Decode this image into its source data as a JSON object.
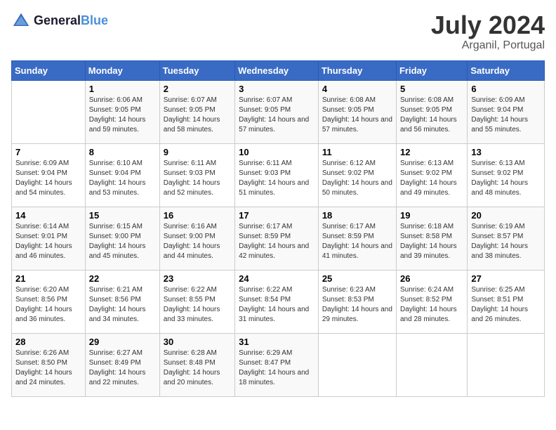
{
  "header": {
    "logo_line1": "General",
    "logo_line2": "Blue",
    "month_year": "July 2024",
    "location": "Arganil, Portugal"
  },
  "weekdays": [
    "Sunday",
    "Monday",
    "Tuesday",
    "Wednesday",
    "Thursday",
    "Friday",
    "Saturday"
  ],
  "weeks": [
    [
      {
        "day": "",
        "sunrise": "",
        "sunset": "",
        "daylight": ""
      },
      {
        "day": "1",
        "sunrise": "Sunrise: 6:06 AM",
        "sunset": "Sunset: 9:05 PM",
        "daylight": "Daylight: 14 hours and 59 minutes."
      },
      {
        "day": "2",
        "sunrise": "Sunrise: 6:07 AM",
        "sunset": "Sunset: 9:05 PM",
        "daylight": "Daylight: 14 hours and 58 minutes."
      },
      {
        "day": "3",
        "sunrise": "Sunrise: 6:07 AM",
        "sunset": "Sunset: 9:05 PM",
        "daylight": "Daylight: 14 hours and 57 minutes."
      },
      {
        "day": "4",
        "sunrise": "Sunrise: 6:08 AM",
        "sunset": "Sunset: 9:05 PM",
        "daylight": "Daylight: 14 hours and 57 minutes."
      },
      {
        "day": "5",
        "sunrise": "Sunrise: 6:08 AM",
        "sunset": "Sunset: 9:05 PM",
        "daylight": "Daylight: 14 hours and 56 minutes."
      },
      {
        "day": "6",
        "sunrise": "Sunrise: 6:09 AM",
        "sunset": "Sunset: 9:04 PM",
        "daylight": "Daylight: 14 hours and 55 minutes."
      }
    ],
    [
      {
        "day": "7",
        "sunrise": "Sunrise: 6:09 AM",
        "sunset": "Sunset: 9:04 PM",
        "daylight": "Daylight: 14 hours and 54 minutes."
      },
      {
        "day": "8",
        "sunrise": "Sunrise: 6:10 AM",
        "sunset": "Sunset: 9:04 PM",
        "daylight": "Daylight: 14 hours and 53 minutes."
      },
      {
        "day": "9",
        "sunrise": "Sunrise: 6:11 AM",
        "sunset": "Sunset: 9:03 PM",
        "daylight": "Daylight: 14 hours and 52 minutes."
      },
      {
        "day": "10",
        "sunrise": "Sunrise: 6:11 AM",
        "sunset": "Sunset: 9:03 PM",
        "daylight": "Daylight: 14 hours and 51 minutes."
      },
      {
        "day": "11",
        "sunrise": "Sunrise: 6:12 AM",
        "sunset": "Sunset: 9:02 PM",
        "daylight": "Daylight: 14 hours and 50 minutes."
      },
      {
        "day": "12",
        "sunrise": "Sunrise: 6:13 AM",
        "sunset": "Sunset: 9:02 PM",
        "daylight": "Daylight: 14 hours and 49 minutes."
      },
      {
        "day": "13",
        "sunrise": "Sunrise: 6:13 AM",
        "sunset": "Sunset: 9:02 PM",
        "daylight": "Daylight: 14 hours and 48 minutes."
      }
    ],
    [
      {
        "day": "14",
        "sunrise": "Sunrise: 6:14 AM",
        "sunset": "Sunset: 9:01 PM",
        "daylight": "Daylight: 14 hours and 46 minutes."
      },
      {
        "day": "15",
        "sunrise": "Sunrise: 6:15 AM",
        "sunset": "Sunset: 9:00 PM",
        "daylight": "Daylight: 14 hours and 45 minutes."
      },
      {
        "day": "16",
        "sunrise": "Sunrise: 6:16 AM",
        "sunset": "Sunset: 9:00 PM",
        "daylight": "Daylight: 14 hours and 44 minutes."
      },
      {
        "day": "17",
        "sunrise": "Sunrise: 6:17 AM",
        "sunset": "Sunset: 8:59 PM",
        "daylight": "Daylight: 14 hours and 42 minutes."
      },
      {
        "day": "18",
        "sunrise": "Sunrise: 6:17 AM",
        "sunset": "Sunset: 8:59 PM",
        "daylight": "Daylight: 14 hours and 41 minutes."
      },
      {
        "day": "19",
        "sunrise": "Sunrise: 6:18 AM",
        "sunset": "Sunset: 8:58 PM",
        "daylight": "Daylight: 14 hours and 39 minutes."
      },
      {
        "day": "20",
        "sunrise": "Sunrise: 6:19 AM",
        "sunset": "Sunset: 8:57 PM",
        "daylight": "Daylight: 14 hours and 38 minutes."
      }
    ],
    [
      {
        "day": "21",
        "sunrise": "Sunrise: 6:20 AM",
        "sunset": "Sunset: 8:56 PM",
        "daylight": "Daylight: 14 hours and 36 minutes."
      },
      {
        "day": "22",
        "sunrise": "Sunrise: 6:21 AM",
        "sunset": "Sunset: 8:56 PM",
        "daylight": "Daylight: 14 hours and 34 minutes."
      },
      {
        "day": "23",
        "sunrise": "Sunrise: 6:22 AM",
        "sunset": "Sunset: 8:55 PM",
        "daylight": "Daylight: 14 hours and 33 minutes."
      },
      {
        "day": "24",
        "sunrise": "Sunrise: 6:22 AM",
        "sunset": "Sunset: 8:54 PM",
        "daylight": "Daylight: 14 hours and 31 minutes."
      },
      {
        "day": "25",
        "sunrise": "Sunrise: 6:23 AM",
        "sunset": "Sunset: 8:53 PM",
        "daylight": "Daylight: 14 hours and 29 minutes."
      },
      {
        "day": "26",
        "sunrise": "Sunrise: 6:24 AM",
        "sunset": "Sunset: 8:52 PM",
        "daylight": "Daylight: 14 hours and 28 minutes."
      },
      {
        "day": "27",
        "sunrise": "Sunrise: 6:25 AM",
        "sunset": "Sunset: 8:51 PM",
        "daylight": "Daylight: 14 hours and 26 minutes."
      }
    ],
    [
      {
        "day": "28",
        "sunrise": "Sunrise: 6:26 AM",
        "sunset": "Sunset: 8:50 PM",
        "daylight": "Daylight: 14 hours and 24 minutes."
      },
      {
        "day": "29",
        "sunrise": "Sunrise: 6:27 AM",
        "sunset": "Sunset: 8:49 PM",
        "daylight": "Daylight: 14 hours and 22 minutes."
      },
      {
        "day": "30",
        "sunrise": "Sunrise: 6:28 AM",
        "sunset": "Sunset: 8:48 PM",
        "daylight": "Daylight: 14 hours and 20 minutes."
      },
      {
        "day": "31",
        "sunrise": "Sunrise: 6:29 AM",
        "sunset": "Sunset: 8:47 PM",
        "daylight": "Daylight: 14 hours and 18 minutes."
      },
      {
        "day": "",
        "sunrise": "",
        "sunset": "",
        "daylight": ""
      },
      {
        "day": "",
        "sunrise": "",
        "sunset": "",
        "daylight": ""
      },
      {
        "day": "",
        "sunrise": "",
        "sunset": "",
        "daylight": ""
      }
    ]
  ]
}
